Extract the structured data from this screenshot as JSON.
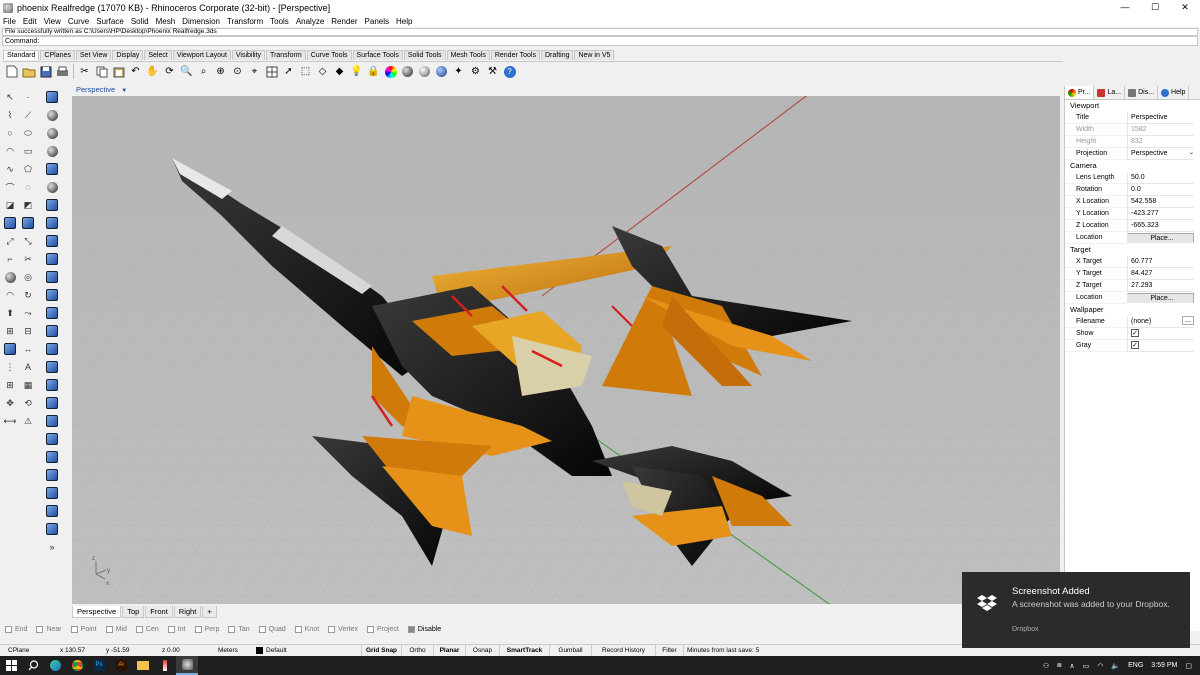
{
  "window": {
    "title": "phoenix Realfredge (17070 KB) - Rhinoceros Corporate (32-bit) - [Perspective]",
    "controls": {
      "minimize": "—",
      "maximize": "☐",
      "close": "✕"
    }
  },
  "menu": [
    "File",
    "Edit",
    "View",
    "Curve",
    "Surface",
    "Solid",
    "Mesh",
    "Dimension",
    "Transform",
    "Tools",
    "Analyze",
    "Render",
    "Panels",
    "Help"
  ],
  "command": {
    "history": "File successfully written as C:\\Users\\HP\\Desktop\\Phoenix Realfredge.3ds",
    "prompt": "Command:"
  },
  "toolbar_tabs": [
    "Standard",
    "CPlanes",
    "Set View",
    "Display",
    "Select",
    "Viewport Layout",
    "Visibility",
    "Transform",
    "Curve Tools",
    "Surface Tools",
    "Solid Tools",
    "Mesh Tools",
    "Render Tools",
    "Drafting",
    "New in V5"
  ],
  "viewport": {
    "label": "Perspective",
    "menu_arrow": "▼",
    "tabs": [
      "Perspective",
      "Top",
      "Front",
      "Right"
    ],
    "add_tab": "+",
    "axis_labels": {
      "z": "z",
      "y": "y",
      "x": "x"
    }
  },
  "osnaps": [
    {
      "label": "End",
      "on": false
    },
    {
      "label": "Near",
      "on": false
    },
    {
      "label": "Point",
      "on": false
    },
    {
      "label": "Mid",
      "on": false
    },
    {
      "label": "Cen",
      "on": false
    },
    {
      "label": "Int",
      "on": false
    },
    {
      "label": "Perp",
      "on": false
    },
    {
      "label": "Tan",
      "on": false
    },
    {
      "label": "Quad",
      "on": false
    },
    {
      "label": "Knot",
      "on": false
    },
    {
      "label": "Vertex",
      "on": false
    },
    {
      "label": "Project",
      "on": false
    },
    {
      "label": "Disable",
      "on": true
    }
  ],
  "status": {
    "cplane": "CPlane",
    "x": "x 130.57",
    "y": "y -51.59",
    "z": "z 0.00",
    "units": "Meters",
    "layer": "Default",
    "buttons": [
      "Grid Snap",
      "Ortho",
      "Planar",
      "Osnap",
      "SmartTrack",
      "Gumball",
      "Record History",
      "Filter"
    ],
    "bold_buttons": [
      "Grid Snap",
      "Planar",
      "SmartTrack"
    ],
    "last_save": "Minutes from last save: 5"
  },
  "panel": {
    "tabs": [
      "Pr...",
      "La...",
      "Dis...",
      "Help"
    ],
    "sections": {
      "viewport": "Viewport",
      "camera": "Camera",
      "target": "Target",
      "wallpaper": "Wallpaper"
    },
    "viewport_rows": {
      "title": {
        "k": "Title",
        "v": "Perspective"
      },
      "width": {
        "k": "Width",
        "v": "1582"
      },
      "height": {
        "k": "Height",
        "v": "832"
      },
      "projection": {
        "k": "Projection",
        "v": "Perspective"
      }
    },
    "camera_rows": {
      "lens": {
        "k": "Lens Length",
        "v": "50.0"
      },
      "rotation": {
        "k": "Rotation",
        "v": "0.0"
      },
      "xloc": {
        "k": "X Location",
        "v": "542.558"
      },
      "yloc": {
        "k": "Y Location",
        "v": "-423.277"
      },
      "zloc": {
        "k": "Z Location",
        "v": "-665.323"
      },
      "loc": {
        "k": "Location",
        "v": "Place..."
      }
    },
    "target_rows": {
      "xt": {
        "k": "X Target",
        "v": "60.777"
      },
      "yt": {
        "k": "Y Target",
        "v": "84.427"
      },
      "zt": {
        "k": "Z Target",
        "v": "27.293"
      },
      "loc": {
        "k": "Location",
        "v": "Place..."
      }
    },
    "wallpaper_rows": {
      "filename": {
        "k": "Filename",
        "v": "(none)",
        "btn": "..."
      },
      "show": {
        "k": "Show"
      },
      "gray": {
        "k": "Gray"
      }
    }
  },
  "toast": {
    "title": "Screenshot Added",
    "body": "A screenshot was added to your Dropbox.",
    "source": "Dropbox"
  },
  "taskbar": {
    "lang": "ENG",
    "time": "3:59 PM"
  },
  "colors": {
    "viewport_bg": "#bbbbbb",
    "model_black": "#141414",
    "model_orange": "#d07a0a",
    "model_gold": "#e8a626",
    "axis_red": "#b04030",
    "axis_green": "#3a9a3a",
    "toast_bg": "#2b2b2b"
  }
}
